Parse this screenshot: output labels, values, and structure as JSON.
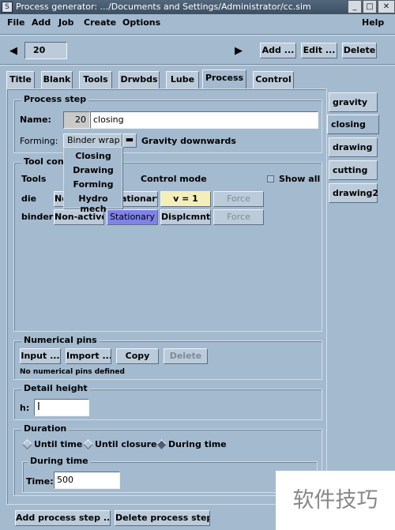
{
  "window": {
    "title": "Process generator: .../Documents and Settings/Administrator/cc.sim",
    "app_icon": "S"
  },
  "menu": {
    "items": [
      "File",
      "Add",
      "Job",
      "Create",
      "Options"
    ],
    "help": "Help"
  },
  "toolbar": {
    "step_value": "20",
    "add_label": "Add ...",
    "edit_label": "Edit ...",
    "delete_label": "Delete"
  },
  "tabs": [
    "Title",
    "Blank",
    "Tools",
    "Drwbds",
    "Lube",
    "Process",
    "Control"
  ],
  "active_tab": "Process",
  "process_step": {
    "group_title": "Process step",
    "name_label": "Name:",
    "step_number": "20",
    "name_value": "closing",
    "forming_label": "Forming:",
    "forming_value": "Binder wrap",
    "gravity_label": "Gravity downwards"
  },
  "forming_options": [
    "Closing",
    "Drawing",
    "Forming",
    "Hydro mech"
  ],
  "tool_control": {
    "group_title": "Tool cont",
    "tools_header": "Tools",
    "control_mode_header": "Control mode",
    "show_all_label": "Show all",
    "rows": [
      {
        "tool": "die",
        "nonactive": "No",
        "stationary": "ationary",
        "displ": "v = 1",
        "force": "Force"
      },
      {
        "tool": "binder",
        "nonactive": "Non-active",
        "stationary": "Stationary",
        "displ": "Displcmnt",
        "force": "Force"
      }
    ]
  },
  "right_tabs": [
    "gravity",
    "closing",
    "drawing",
    "cutting",
    "drawing2"
  ],
  "active_right_tab": "closing",
  "numerical_pins": {
    "group_title": "Numerical pins",
    "input_label": "Input ...",
    "import_label": "Import ...",
    "copy_label": "Copy",
    "delete_label": "Delete",
    "status": "No numerical pins defined"
  },
  "detail_height": {
    "group_title": "Detail height",
    "h_label": "h:",
    "h_value": ""
  },
  "duration": {
    "group_title": "Duration",
    "options": [
      "Until time",
      "Until closure",
      "During time"
    ],
    "selected": "During time",
    "during_time": {
      "group_title": "During time",
      "time_label": "Time:",
      "time_value": "500"
    }
  },
  "bottom": {
    "add_step_label": "Add process step ...",
    "delete_step_label": "Delete process step"
  },
  "watermark": "软件技巧"
}
